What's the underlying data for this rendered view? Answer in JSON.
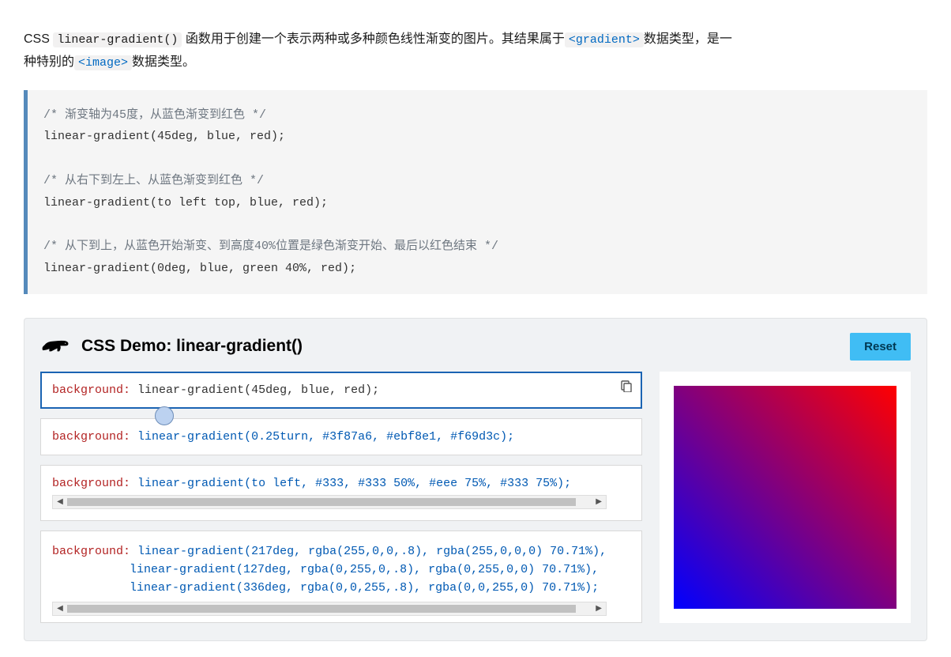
{
  "intro": {
    "pre": "CSS ",
    "func": "linear-gradient()",
    "mid1": " 函数用于创建一个表示两种或多种颜色线性渐变的图片。其结果属于",
    "type1": "<gradient>",
    "mid2": "数据类型，是一种特别的",
    "type2": "<image>",
    "mid3": "数据类型。"
  },
  "code_block": {
    "c1": "/* 渐变轴为45度，从蓝色渐变到红色 */",
    "l1": "linear-gradient(45deg, blue, red);",
    "c2": "/* 从右下到左上、从蓝色渐变到红色 */",
    "l2": "linear-gradient(to left top, blue, red);",
    "c3": "/* 从下到上，从蓝色开始渐变、到高度40%位置是绿色渐变开始、最后以红色结束 */",
    "l3": "linear-gradient(0deg, blue, green 40%, red);"
  },
  "demo": {
    "title": "CSS Demo: linear-gradient()",
    "reset": "Reset",
    "prop": "background:",
    "choices": [
      {
        "fn": "linear-gradient",
        "args": "(45deg, blue, red);"
      },
      {
        "fn": "linear-gradient",
        "args": "(0.25turn, #3f87a6, #ebf8e1, #f69d3c);"
      },
      {
        "fn": "linear-gradient",
        "args": "(to left, #333, #333 50%, #eee 75%, #333 75%);"
      }
    ],
    "choice4": {
      "l1": {
        "fn": "linear-gradient",
        "args": "(217deg, rgba(255,0,0,.8), rgba(255,0,0,0) 70.71%),"
      },
      "l2": {
        "fn": "linear-gradient",
        "args": "(127deg, rgba(0,255,0,.8), rgba(0,255,0,0) 70.71%),"
      },
      "l3": {
        "fn": "linear-gradient",
        "args": "(336deg, rgba(0,0,255,.8), rgba(0,0,255,0) 70.71%);"
      }
    }
  }
}
